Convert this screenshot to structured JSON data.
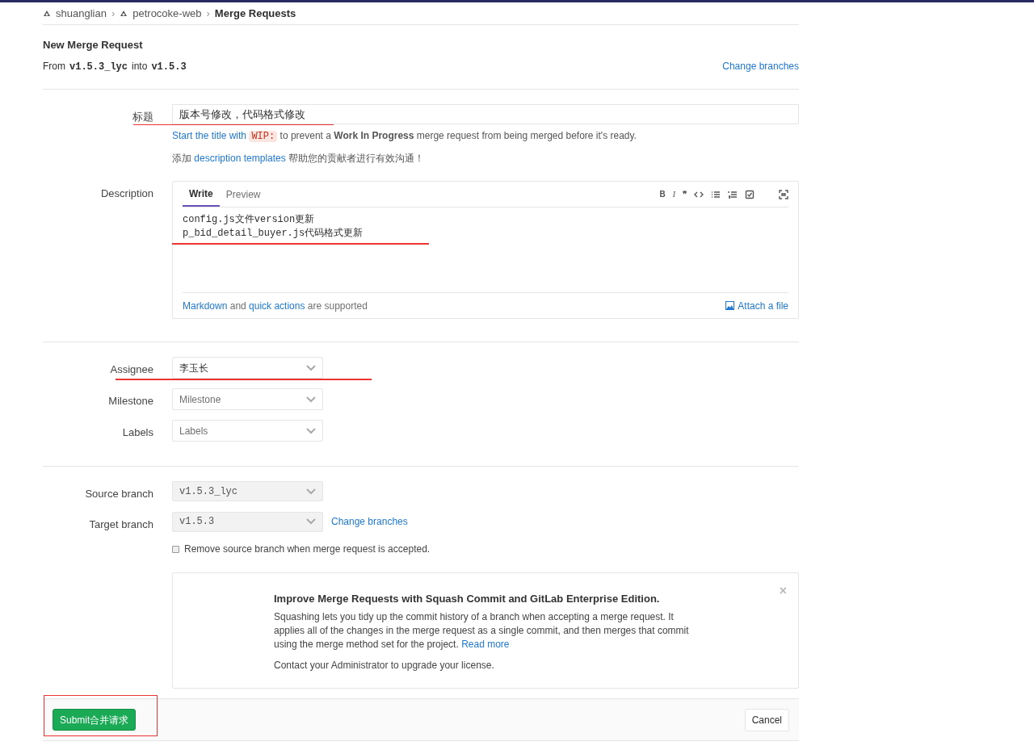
{
  "breadcrumb_separator": "›",
  "breadcrumb": [
    {
      "label": "shuanglian",
      "icon": true
    },
    {
      "label": "petrocoke-web",
      "icon": true
    },
    {
      "label": "Merge Requests",
      "icon": false
    }
  ],
  "header": {
    "title": "New Merge Request",
    "from_label": "From",
    "source": "v1.5.3_lyc",
    "into_label": "into",
    "target": "v1.5.3",
    "change_link": "Change branches"
  },
  "title_field": {
    "label": "标题",
    "value": "版本号修改，代码格式修改"
  },
  "wip_hint": {
    "link": "Start the title with",
    "code": "WIP:",
    "before": "to prevent a",
    "bold": "Work In Progress",
    "after": "merge request from being merged before it's ready."
  },
  "templates_hint": {
    "before": "添加",
    "link": "description templates",
    "after": "帮助您的贡献者进行有效沟通！"
  },
  "description": {
    "label": "Description",
    "tabs": [
      {
        "label": "Write",
        "selected": true
      },
      {
        "label": "Preview",
        "selected": false
      }
    ],
    "toolbar_letters": [
      "B",
      "I",
      "❞"
    ],
    "lines": [
      "config.js文件version更新",
      "p_bid_detail_buyer.js代码格式更新"
    ],
    "footer_link1": "Markdown",
    "footer_and": "and",
    "footer_link2": "quick actions",
    "footer_rest": "are supported",
    "attach": "Attach a file"
  },
  "selects": [
    {
      "label": "Assignee",
      "value": "李玉长",
      "placeholder": false
    },
    {
      "label": "Milestone",
      "value": "Milestone",
      "placeholder": true
    },
    {
      "label": "Labels",
      "value": "Labels",
      "placeholder": true
    }
  ],
  "branches": [
    {
      "label": "Source branch",
      "value": "v1.5.3_lyc"
    },
    {
      "label": "Target branch",
      "value": "v1.5.3",
      "link": "Change branches"
    }
  ],
  "remove_source": {
    "label": "Remove source branch when merge request is accepted.",
    "checked": false
  },
  "promo": {
    "title": "Improve Merge Requests with Squash Commit and GitLab Enterprise Edition.",
    "body": "Squashing lets you tidy up the commit history of a branch when accepting a merge request. It applies all of the changes in the merge request as a single commit, and then merges that commit using the merge method set for the project.",
    "link": "Read more",
    "contact": "Contact your Administrator to upgrade your license.",
    "close": "×"
  },
  "actions": {
    "submit": "Submit合并请求",
    "cancel": "Cancel"
  }
}
